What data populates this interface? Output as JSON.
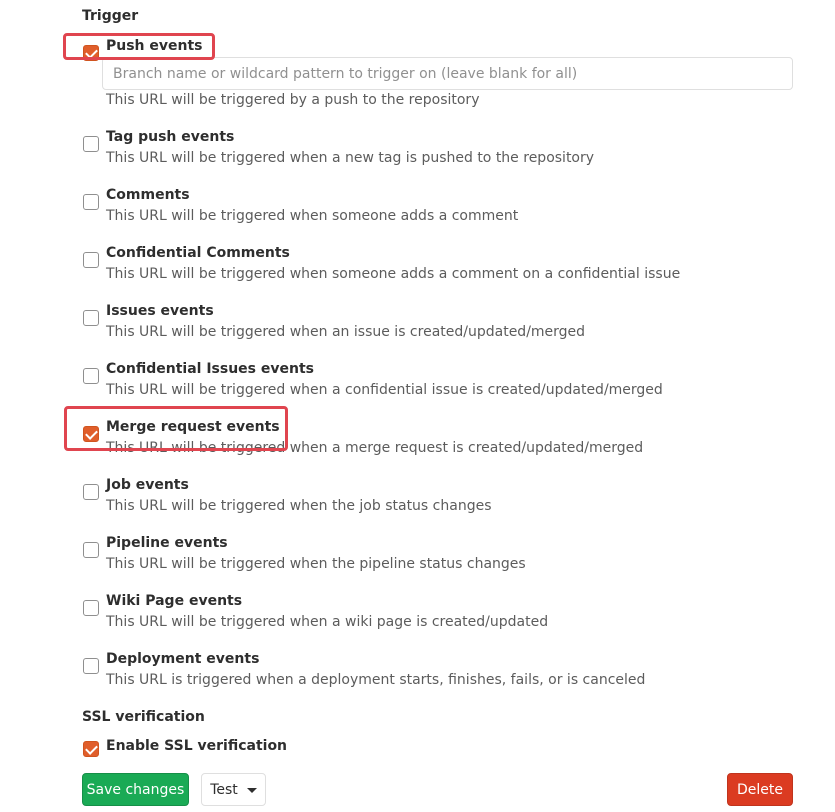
{
  "trigger": {
    "title": "Trigger",
    "branch_filter": {
      "placeholder": "Branch name or wildcard pattern to trigger on (leave blank for all)",
      "value": ""
    },
    "events": [
      {
        "label": "Push events",
        "help": "This URL will be triggered by a push to the repository",
        "checked": true
      },
      {
        "label": "Tag push events",
        "help": "This URL will be triggered when a new tag is pushed to the repository",
        "checked": false
      },
      {
        "label": "Comments",
        "help": "This URL will be triggered when someone adds a comment",
        "checked": false
      },
      {
        "label": "Confidential Comments",
        "help": "This URL will be triggered when someone adds a comment on a confidential issue",
        "checked": false
      },
      {
        "label": "Issues events",
        "help": "This URL will be triggered when an issue is created/updated/merged",
        "checked": false
      },
      {
        "label": "Confidential Issues events",
        "help": "This URL will be triggered when a confidential issue is created/updated/merged",
        "checked": false
      },
      {
        "label": "Merge request events",
        "help": "This URL will be triggered when a merge request is created/updated/merged",
        "checked": true
      },
      {
        "label": "Job events",
        "help": "This URL will be triggered when the job status changes",
        "checked": false
      },
      {
        "label": "Pipeline events",
        "help": "This URL will be triggered when the pipeline status changes",
        "checked": false
      },
      {
        "label": "Wiki Page events",
        "help": "This URL will be triggered when a wiki page is created/updated",
        "checked": false
      },
      {
        "label": "Deployment events",
        "help": "This URL is triggered when a deployment starts, finishes, fails, or is canceled",
        "checked": false
      }
    ]
  },
  "ssl": {
    "title": "SSL verification",
    "label": "Enable SSL verification",
    "checked": true
  },
  "actions": {
    "save_label": "Save changes",
    "test_label": "Test",
    "delete_label": "Delete"
  },
  "colors": {
    "checkbox_checked": "#e05e2b",
    "highlight": "#e0454f",
    "save_button": "#1aaa55",
    "delete_button": "#db3b21"
  }
}
